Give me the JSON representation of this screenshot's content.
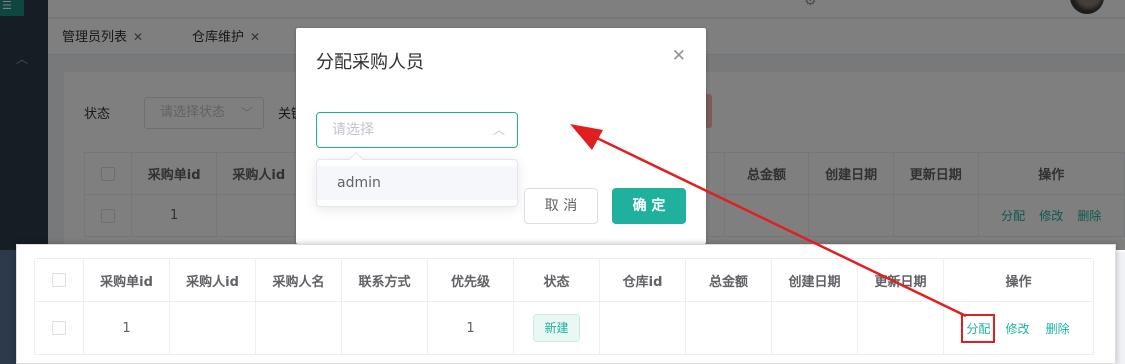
{
  "tabs": [
    {
      "label": "管理员列表"
    },
    {
      "label": "仓库维护"
    }
  ],
  "filter": {
    "status_label": "状态",
    "status_placeholder": "请选择状态",
    "keyword_label": "关键字"
  },
  "table": {
    "columns": [
      "采购单id",
      "采购人id",
      "采购人名",
      "联系方式",
      "优先级",
      "状态",
      "仓库id",
      "总金额",
      "创建日期",
      "更新日期",
      "操作"
    ],
    "rows": [
      {
        "id": "1",
        "buyer_id": "",
        "buyer_name": "",
        "contact": "",
        "priority": "1",
        "status": "新建",
        "warehouse_id": "",
        "total": "",
        "created": "",
        "updated": ""
      }
    ],
    "actions": {
      "assign": "分配",
      "edit": "修改",
      "delete": "删除"
    }
  },
  "dialog": {
    "title": "分配采购人员",
    "select_placeholder": "请选择",
    "options": [
      "admin"
    ],
    "cancel": "取 消",
    "confirm": "确 定"
  },
  "colors": {
    "accent": "#1fb19e",
    "highlight": "#e02020",
    "sidebar": "#2d3a4b"
  }
}
